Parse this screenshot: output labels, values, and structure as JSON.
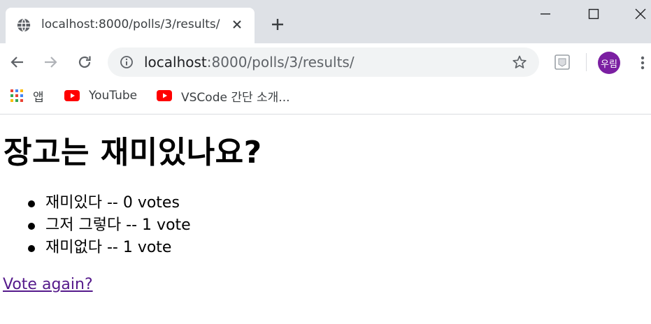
{
  "tab": {
    "title": "localhost:8000/polls/3/results/",
    "icon": "globe-icon"
  },
  "address_bar": {
    "host": "localhost",
    "rest": ":8000/polls/3/results/"
  },
  "profile": {
    "avatar_label": "우림",
    "color": "#7b1fa2"
  },
  "bookmarks": [
    {
      "label": "앱",
      "icon": "apps-grid-icon"
    },
    {
      "label": "YouTube",
      "icon": "youtube-icon"
    },
    {
      "label": "VSCode 간단 소개...",
      "icon": "youtube-icon"
    }
  ],
  "page": {
    "question": "장고는 재미있나요?",
    "results": [
      {
        "text": "재미있다 -- 0 votes"
      },
      {
        "text": "그저 그렇다 -- 1 vote"
      },
      {
        "text": "재미없다 -- 1 vote"
      }
    ],
    "vote_again_link": "Vote again?"
  },
  "colors": {
    "tabstrip_bg": "#dee1e6",
    "omnibox_bg": "#f1f3f4",
    "visited_link": "#551a8b",
    "youtube_red": "#ff0000"
  }
}
